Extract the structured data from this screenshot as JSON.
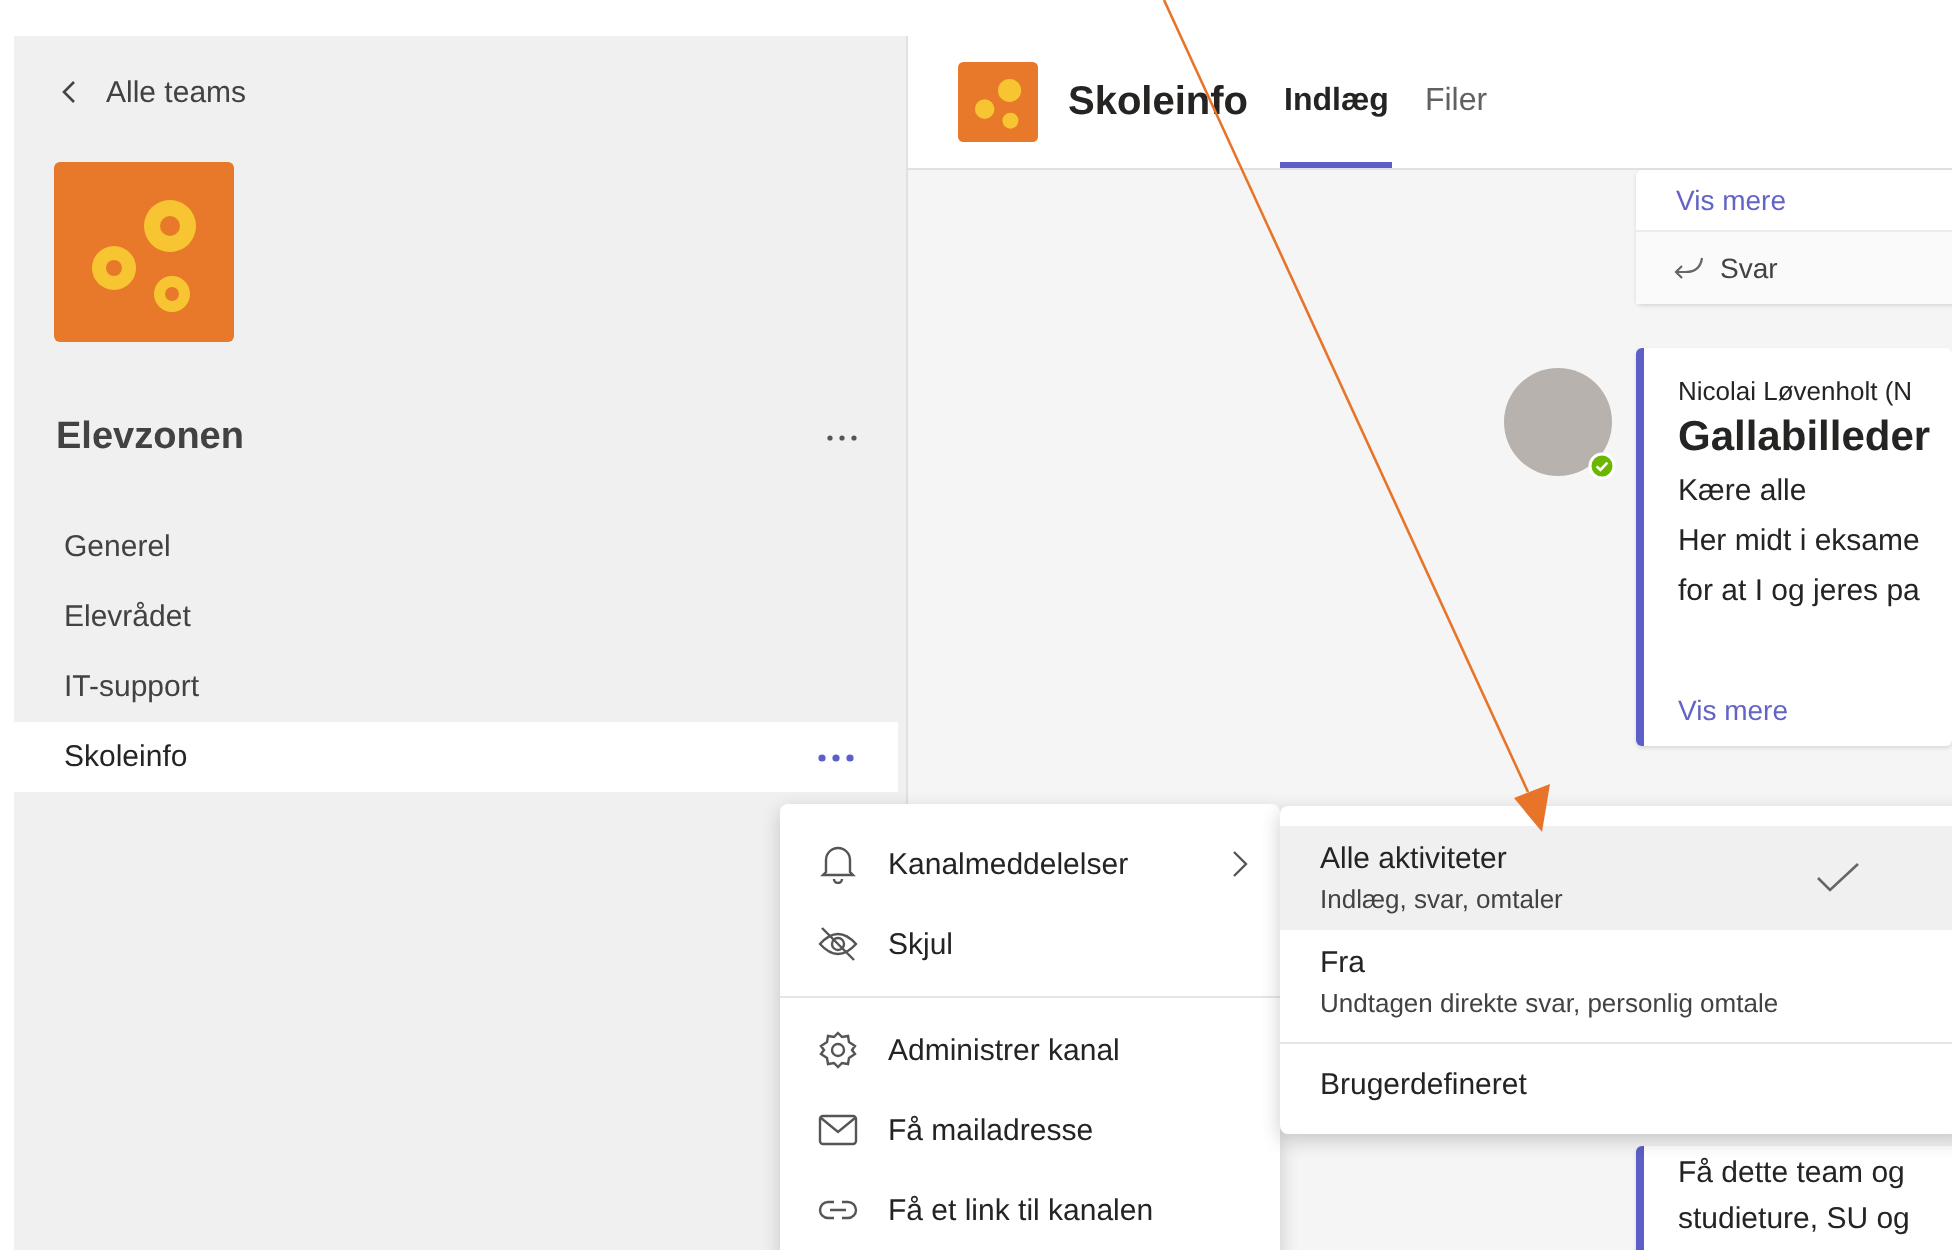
{
  "left_panel": {
    "back_link": "Alle teams",
    "team_name": "Elevzonen",
    "channels": [
      {
        "name": "Generel",
        "selected": false
      },
      {
        "name": "Elevrådet",
        "selected": false
      },
      {
        "name": "IT-support",
        "selected": false
      },
      {
        "name": "Skoleinfo",
        "selected": true
      }
    ]
  },
  "header": {
    "channel_title": "Skoleinfo",
    "tabs": [
      {
        "label": "Indlæg",
        "selected": true
      },
      {
        "label": "Filer",
        "selected": false
      }
    ]
  },
  "posts": [
    {
      "kind": "tail",
      "show_more": "Vis mere",
      "reply": "Svar"
    },
    {
      "kind": "message",
      "author": "Nicolai Løvenholt (N",
      "title": "Gallabilleder",
      "lines": [
        "Kære alle",
        "Her midt i eksame",
        "for at I og jeres pa"
      ],
      "show_more": "Vis mere"
    },
    {
      "kind": "partial",
      "lines": [
        "Få dette team og",
        "studieture, SU og"
      ]
    }
  ],
  "context_menu": {
    "groups": [
      [
        {
          "label": "Kanalmeddelelser",
          "has_submenu": true
        },
        {
          "label": "Skjul",
          "has_submenu": false
        }
      ],
      [
        {
          "label": "Administrer kanal",
          "has_submenu": false
        },
        {
          "label": "Få mailadresse",
          "has_submenu": false
        },
        {
          "label": "Få et link til kanalen",
          "has_submenu": false
        }
      ]
    ]
  },
  "submenu": {
    "options": [
      {
        "label": "Alle aktiviteter",
        "description": "Indlæg, svar, omtaler",
        "selected": true
      },
      {
        "label": "Fra",
        "description": "Undtagen direkte svar, personlig omtale",
        "selected": false
      },
      {
        "label": "Brugerdefineret",
        "selected": false
      }
    ]
  }
}
